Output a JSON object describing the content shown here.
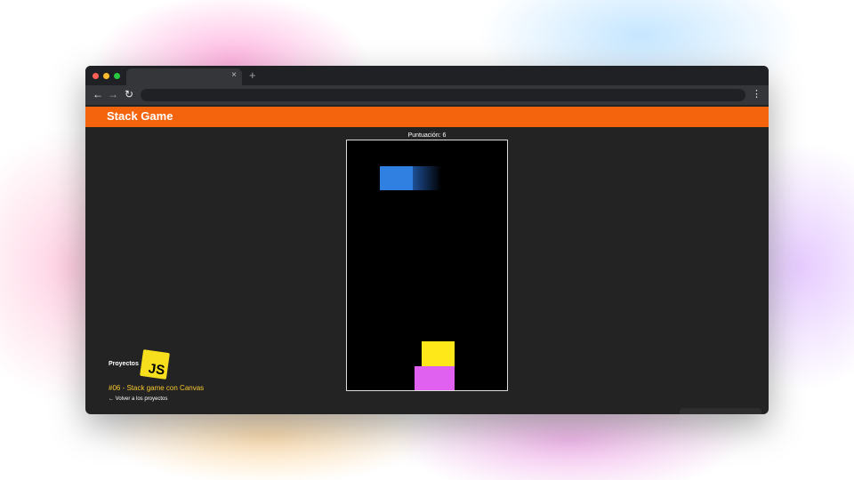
{
  "browser": {
    "tab_close": "×",
    "new_tab": "+",
    "nav_back": "←",
    "nav_forward": "→",
    "nav_reload": "↻",
    "menu": "⋮"
  },
  "site": {
    "title": "Stack Game"
  },
  "game": {
    "score_label": "Puntuación: 6",
    "blocks": [
      {
        "name": "moving-block",
        "color": "#2f80e0"
      },
      {
        "name": "top-stacked-block",
        "color": "#ffe81a"
      },
      {
        "name": "base-block",
        "color": "#e060f0"
      }
    ]
  },
  "footer": {
    "projects_label": "Proyectos",
    "logo_text": "JS",
    "project_title": "#06 - Stack game con Canvas",
    "back_link": "← Volver a los proyectos"
  }
}
